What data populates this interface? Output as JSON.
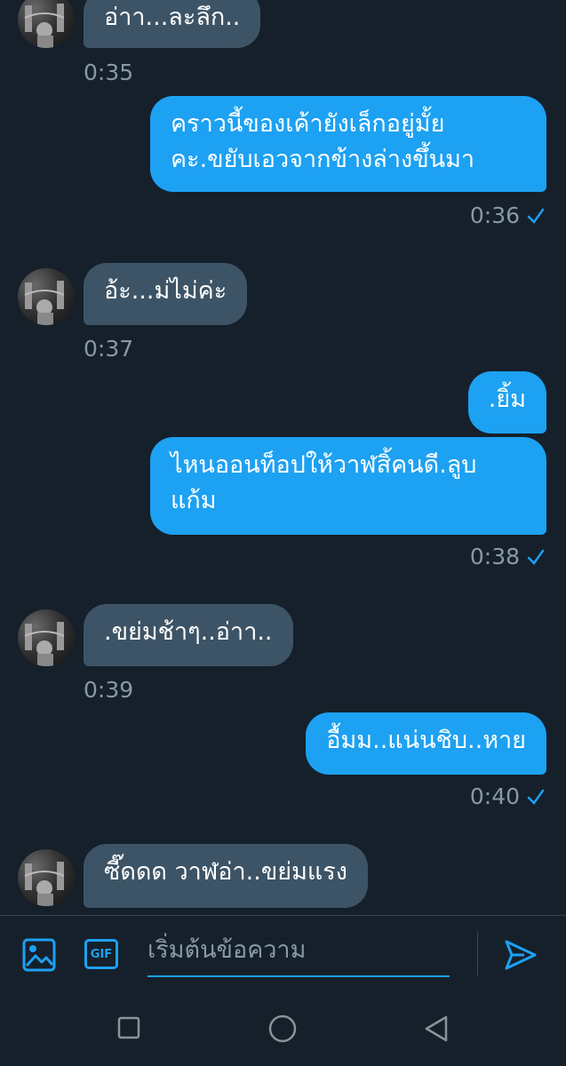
{
  "messages": [
    {
      "side": "in",
      "text": "อ่าา...ละลึก..",
      "time": "0:35"
    },
    {
      "side": "out",
      "text": "คราวนี้ของเค้ายังเล็กอยู่มั้ย\nคะ.ขยับเอวจากข้างล่างขึ้นมา",
      "time": "0:36"
    },
    {
      "side": "in",
      "text": "อ้ะ...ม่ไม่ค่ะ",
      "time": "0:37"
    },
    {
      "side": "out",
      "text": ".ยิ้ม"
    },
    {
      "side": "out",
      "text": "ไหนออนท็อปให้วาฬสิ้คนดี.ลูบ\nแก้ม",
      "time": "0:38"
    },
    {
      "side": "in",
      "text": ".ขย่มช้าๆ..อ่าา..",
      "time": "0:39"
    },
    {
      "side": "out",
      "text": "อื้มม..แน่นชิบ..หาย",
      "time": "0:40"
    },
    {
      "side": "in",
      "text": "ซี๊ดดด วาฬอ่า..ขย่มแรง"
    }
  ],
  "composer": {
    "placeholder": "เริ่มต้นข้อความ",
    "image_icon": "image-icon",
    "gif_icon": "gif-icon",
    "gif_label": "GIF",
    "send_icon": "send-icon"
  },
  "navbar": {
    "icons": [
      "recents-square-icon",
      "home-circle-icon",
      "back-triangle-icon"
    ]
  },
  "colors": {
    "background": "#15202b",
    "outgoing": "#1da1f2",
    "incoming": "#3d5466",
    "muted": "#8899a6"
  }
}
